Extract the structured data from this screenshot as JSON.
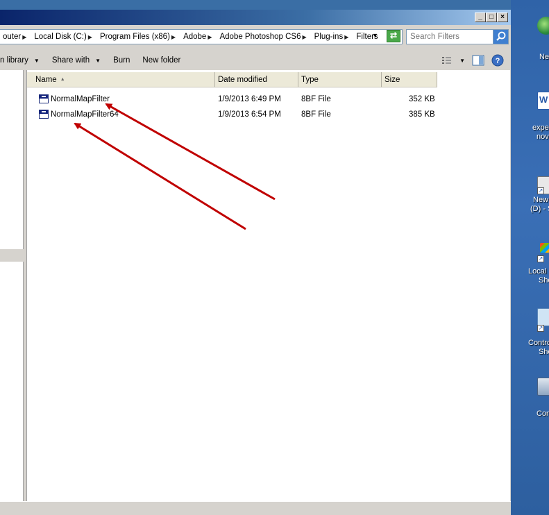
{
  "address": {
    "crumbs": [
      "outer",
      "Local Disk (C:)",
      "Program Files (x86)",
      "Adobe",
      "Adobe Photoshop CS6",
      "Plug-ins",
      "Filters"
    ]
  },
  "search": {
    "placeholder": "Search Filters"
  },
  "toolbar": {
    "library_label": "n library",
    "share_label": "Share with",
    "burn_label": "Burn",
    "new_folder_label": "New folder"
  },
  "columns": {
    "name": "Name",
    "date": "Date modified",
    "type": "Type",
    "size": "Size"
  },
  "files": [
    {
      "name": "NormalMapFilter",
      "date": "1/9/2013 6:49 PM",
      "type": "8BF File",
      "size": "352 KB"
    },
    {
      "name": "NormalMapFilter64",
      "date": "1/9/2013 6:54 PM",
      "type": "8BF File",
      "size": "385 KB"
    }
  ],
  "desktop": {
    "icons": [
      {
        "label": "Ne",
        "icon": "globe-icon"
      },
      {
        "label": "expe",
        "label2": "nov",
        "icon": "word-document-icon"
      },
      {
        "label": "New",
        "label2": "(D) - S",
        "icon": "drive-shortcut-icon"
      },
      {
        "label": "Local D",
        "label2": "Sho",
        "icon": "local-disk-shortcut-icon"
      },
      {
        "label": "Contro",
        "label2": "Sho",
        "icon": "control-panel-shortcut-icon"
      },
      {
        "label": "Com",
        "icon": "computer-icon"
      }
    ]
  },
  "colors": {
    "annotation_arrow": "#c00000",
    "desktop_bg": "#3a6ea5",
    "window_chrome": "#d6d3ce"
  }
}
